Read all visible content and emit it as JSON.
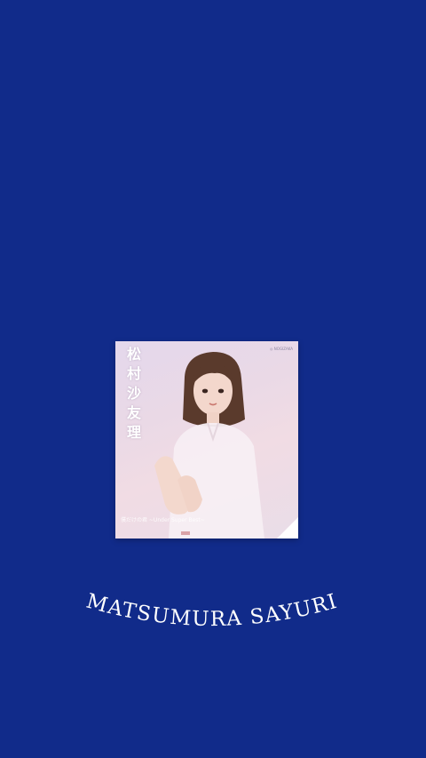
{
  "card": {
    "vertical_name": "松村沙友理",
    "brand_mark": "◎ NOGIZAKA",
    "subtitle": "僕だけの君 ~Under Super Best~"
  },
  "arc_title": "MATSUMURA SAYURI",
  "colors": {
    "background": "#112b8a",
    "title_text": "#ffffff",
    "card_gradient_top": "#e4d8ec",
    "card_gradient_bottom": "#f1dce4"
  }
}
